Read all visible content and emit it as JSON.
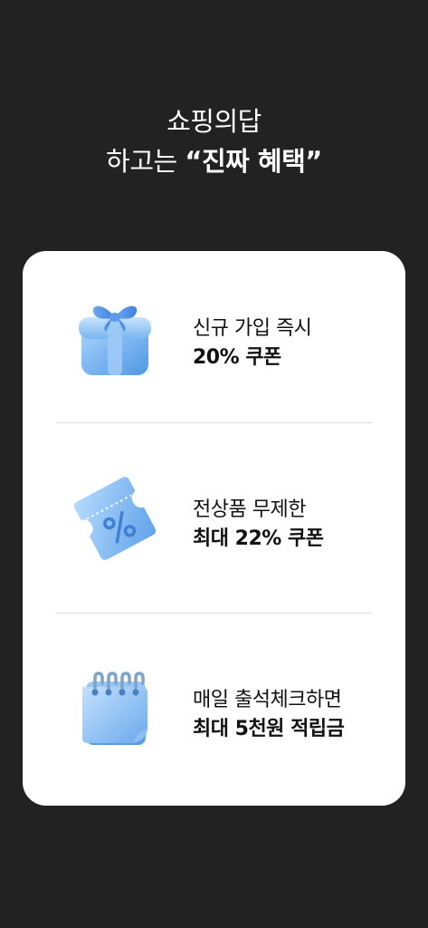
{
  "headline": {
    "line1": "쇼핑의답",
    "line2_prefix": "하고는 ",
    "line2_strong": "“진짜 혜택”"
  },
  "benefits": [
    {
      "icon": "gift-box-icon",
      "line1": "신규 가입 즉시",
      "line2": "20% 쿠폰"
    },
    {
      "icon": "coupon-ticket-icon",
      "line1": "전상품 무제한",
      "line2": "최대 22% 쿠폰"
    },
    {
      "icon": "calendar-icon",
      "line1": "매일 출석체크하면",
      "line2": "최대 5천원 적립금"
    }
  ],
  "colors": {
    "background": "#222222",
    "card": "#ffffff",
    "icon_blue": "#7db8f0",
    "text": "#111111"
  }
}
